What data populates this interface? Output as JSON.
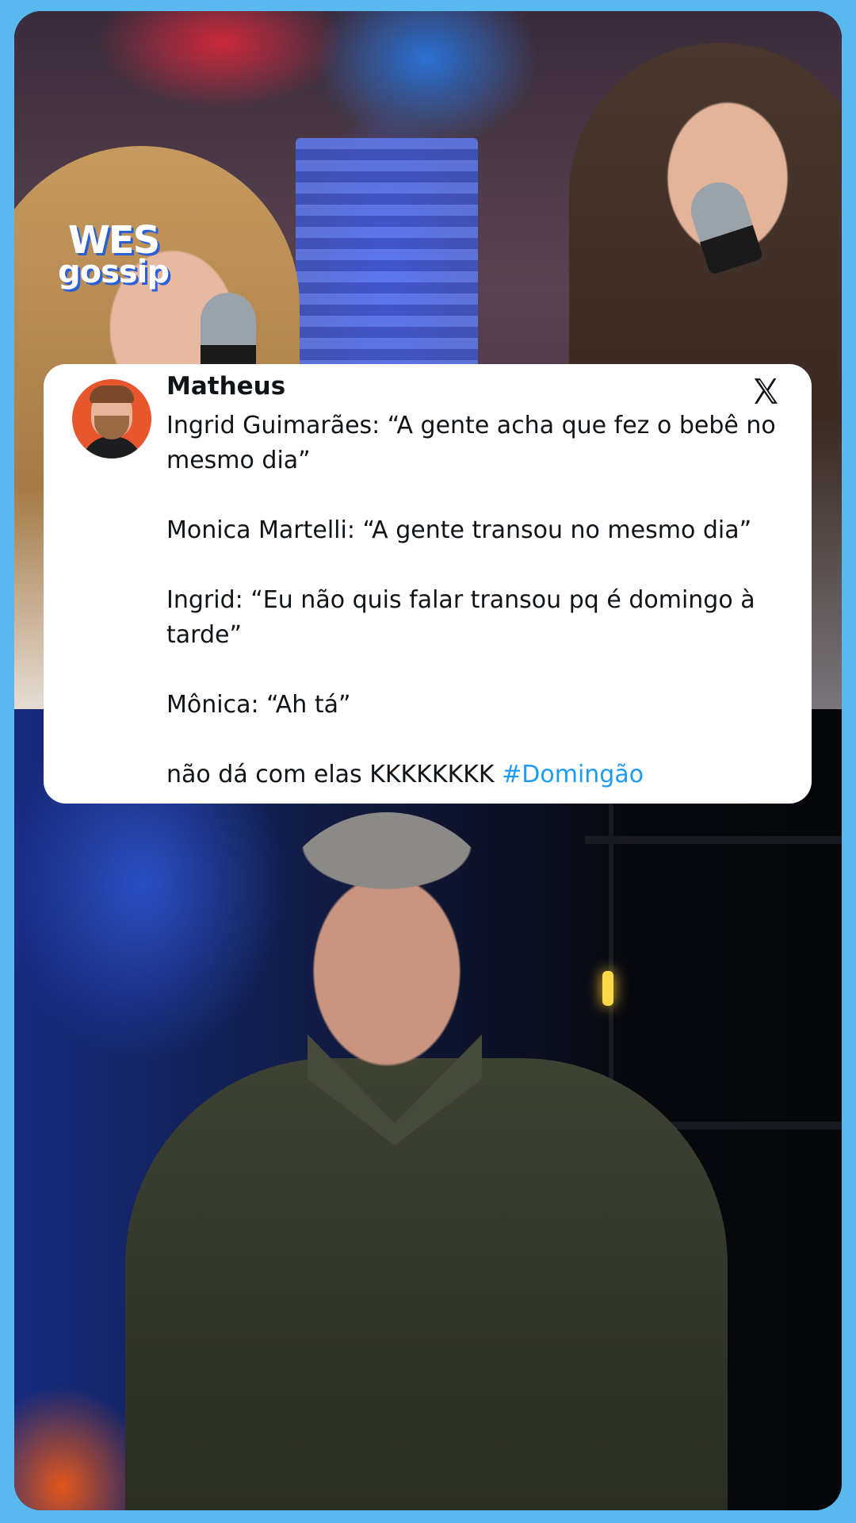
{
  "brand": {
    "line1": "WES",
    "line2": "gossip"
  },
  "tweet": {
    "username": "Matheus",
    "platform_icon": "x-logo-icon",
    "lines": [
      "Ingrid Guimarães: “A gente acha que fez o bebê no mesmo dia”",
      "Monica Martelli: “A gente transou no mesmo dia”",
      "Ingrid: “Eu não quis falar transou pq é domingo à tarde”",
      "Mônica: “Ah tá”"
    ],
    "last_line_text": "não dá com elas KKKKKKKK ",
    "hashtag": "#Domingão"
  },
  "colors": {
    "background": "#59b8ee",
    "hashtag": "#1d9bf0",
    "avatar_bg": "#e8562e"
  }
}
